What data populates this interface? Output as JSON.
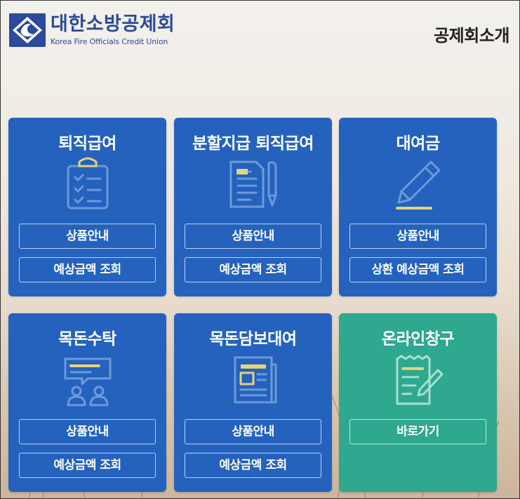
{
  "header": {
    "logo_kr": "대한소방공제회",
    "logo_en": "Korea Fire Officials Credit Union",
    "page_title": "공제회소개"
  },
  "cards": [
    {
      "title": "퇴직급여",
      "icon": "clipboard-checklist-icon",
      "buttons": [
        "상품안내",
        "예상금액 조회"
      ]
    },
    {
      "title": "분할지급 퇴직급여",
      "icon": "document-pen-icon",
      "buttons": [
        "상품안내",
        "예상금액 조회"
      ]
    },
    {
      "title": "대여금",
      "icon": "pencil-icon",
      "buttons": [
        "상품안내",
        "상환 예상금액 조회"
      ]
    },
    {
      "title": "목돈수탁",
      "icon": "people-chat-icon",
      "buttons": [
        "상품안내",
        "예상금액 조회"
      ]
    },
    {
      "title": "목돈담보대여",
      "icon": "newspaper-icon",
      "buttons": [
        "상품안내",
        "예상금액 조회"
      ]
    },
    {
      "title": "온라인창구",
      "icon": "receipt-pen-icon",
      "buttons": [
        "바로가기"
      ]
    }
  ],
  "colors": {
    "card_blue": "#2462be",
    "card_green": "#2ea88f",
    "icon_line": "#6e9ad8",
    "icon_accent": "#e6d27a",
    "brand": "#2b4a9a"
  }
}
